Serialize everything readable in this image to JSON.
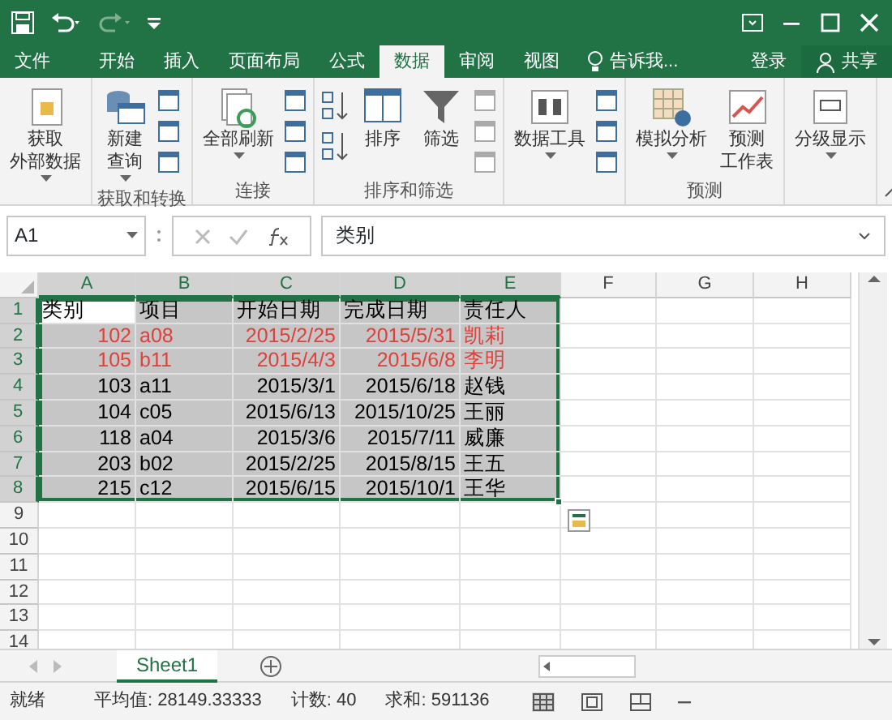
{
  "tabs": [
    {
      "label": "文件",
      "selected": false
    },
    {
      "label": "开始",
      "selected": false
    },
    {
      "label": "插入",
      "selected": false
    },
    {
      "label": "页面布局",
      "selected": false
    },
    {
      "label": "公式",
      "selected": false
    },
    {
      "label": "数据",
      "selected": true
    },
    {
      "label": "审阅",
      "selected": false
    },
    {
      "label": "视图",
      "selected": false
    }
  ],
  "tell_me": "告诉我...",
  "sign_in": "登录",
  "share": "共享",
  "ribbon": {
    "groups": [
      {
        "buttons": [
          {
            "lines": [
              "获取",
              "外部数据"
            ],
            "dropdown": true
          }
        ]
      },
      {
        "label": "获取和转换",
        "buttons": [
          {
            "lines": [
              "新建",
              "查询"
            ],
            "dropdown": true
          }
        ]
      },
      {
        "label": "连接",
        "buttons": [
          {
            "lines": [
              "全部刷新"
            ],
            "dropdown": true
          }
        ]
      },
      {
        "label": "排序和筛选",
        "buttons": [
          {
            "lines": [
              "排序"
            ],
            "dropdown": false
          },
          {
            "lines": [
              "筛选"
            ],
            "dropdown": false
          }
        ]
      },
      {
        "buttons": [
          {
            "lines": [
              "数据工具"
            ],
            "dropdown": true
          }
        ]
      },
      {
        "label": "预测",
        "buttons": [
          {
            "lines": [
              "模拟分析"
            ],
            "dropdown": true
          },
          {
            "lines": [
              "预测",
              "工作表"
            ],
            "dropdown": false
          }
        ]
      },
      {
        "buttons": [
          {
            "lines": [
              "分级显示"
            ],
            "dropdown": true
          }
        ]
      }
    ]
  },
  "formula_bar": {
    "name_box": "A1",
    "value": "类别"
  },
  "sheet": {
    "columns": [
      {
        "label": "A",
        "selected": true
      },
      {
        "label": "B",
        "selected": true
      },
      {
        "label": "C",
        "selected": true
      },
      {
        "label": "D",
        "selected": true
      },
      {
        "label": "E",
        "selected": true
      },
      {
        "label": "F",
        "selected": false
      },
      {
        "label": "G",
        "selected": false
      },
      {
        "label": "H",
        "selected": false
      }
    ],
    "rows": [
      {
        "number": "1",
        "selected": true,
        "highlighted": false,
        "cells": [
          "类别",
          "项目",
          "开始日期",
          "完成日期",
          "责任人"
        ]
      },
      {
        "number": "2",
        "selected": true,
        "highlighted": true,
        "cells": [
          "102",
          "a08",
          "2015/2/25",
          "2015/5/31",
          "凯莉"
        ]
      },
      {
        "number": "3",
        "selected": true,
        "highlighted": true,
        "cells": [
          "105",
          "b11",
          "2015/4/3",
          "2015/6/8",
          "李明"
        ]
      },
      {
        "number": "4",
        "selected": true,
        "highlighted": false,
        "cells": [
          "103",
          "a11",
          "2015/3/1",
          "2015/6/18",
          "赵钱"
        ]
      },
      {
        "number": "5",
        "selected": true,
        "highlighted": false,
        "cells": [
          "104",
          "c05",
          "2015/6/13",
          "2015/10/25",
          "王丽"
        ]
      },
      {
        "number": "6",
        "selected": true,
        "highlighted": false,
        "cells": [
          "118",
          "a04",
          "2015/3/6",
          "2015/7/11",
          "威廉"
        ]
      },
      {
        "number": "7",
        "selected": true,
        "highlighted": false,
        "cells": [
          "203",
          "b02",
          "2015/2/25",
          "2015/8/15",
          "王五"
        ]
      },
      {
        "number": "8",
        "selected": true,
        "highlighted": false,
        "cells": [
          "215",
          "c12",
          "2015/6/15",
          "2015/10/1",
          "王华"
        ]
      },
      {
        "number": "9",
        "selected": false
      },
      {
        "number": "10",
        "selected": false
      },
      {
        "number": "11",
        "selected": false
      },
      {
        "number": "12",
        "selected": false
      },
      {
        "number": "13",
        "selected": false
      },
      {
        "number": "14",
        "selected": false
      }
    ]
  },
  "sheet_tabs": [
    {
      "label": "Sheet1",
      "selected": true
    }
  ],
  "status_bar": {
    "status": "就绪",
    "average": "平均值: 28149.33333",
    "count": "计数: 40",
    "sum": "求和: 591136"
  }
}
